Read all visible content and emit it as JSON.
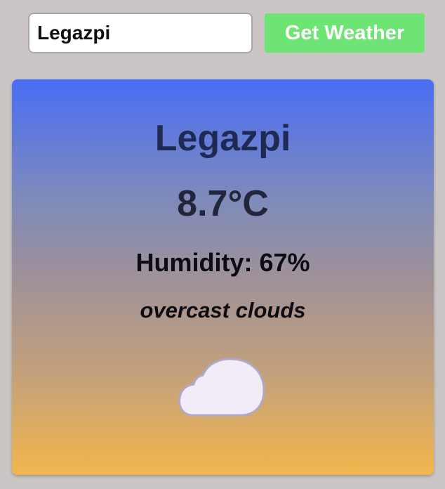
{
  "search": {
    "value": "Legazpi"
  },
  "button": {
    "label": "Get Weather"
  },
  "weather": {
    "city": "Legazpi",
    "temperature": "8.7°C",
    "humidity": "Humidity: 67%",
    "description": "overcast clouds",
    "icon": "cloud-icon"
  },
  "colors": {
    "background": "#cbc6c5",
    "button": "#6de473",
    "gradient_top": "#4a6ef4",
    "gradient_bottom": "#f2b64d",
    "cloud_fill": "#f1ecf7",
    "cloud_stroke": "#b0a8c6"
  }
}
